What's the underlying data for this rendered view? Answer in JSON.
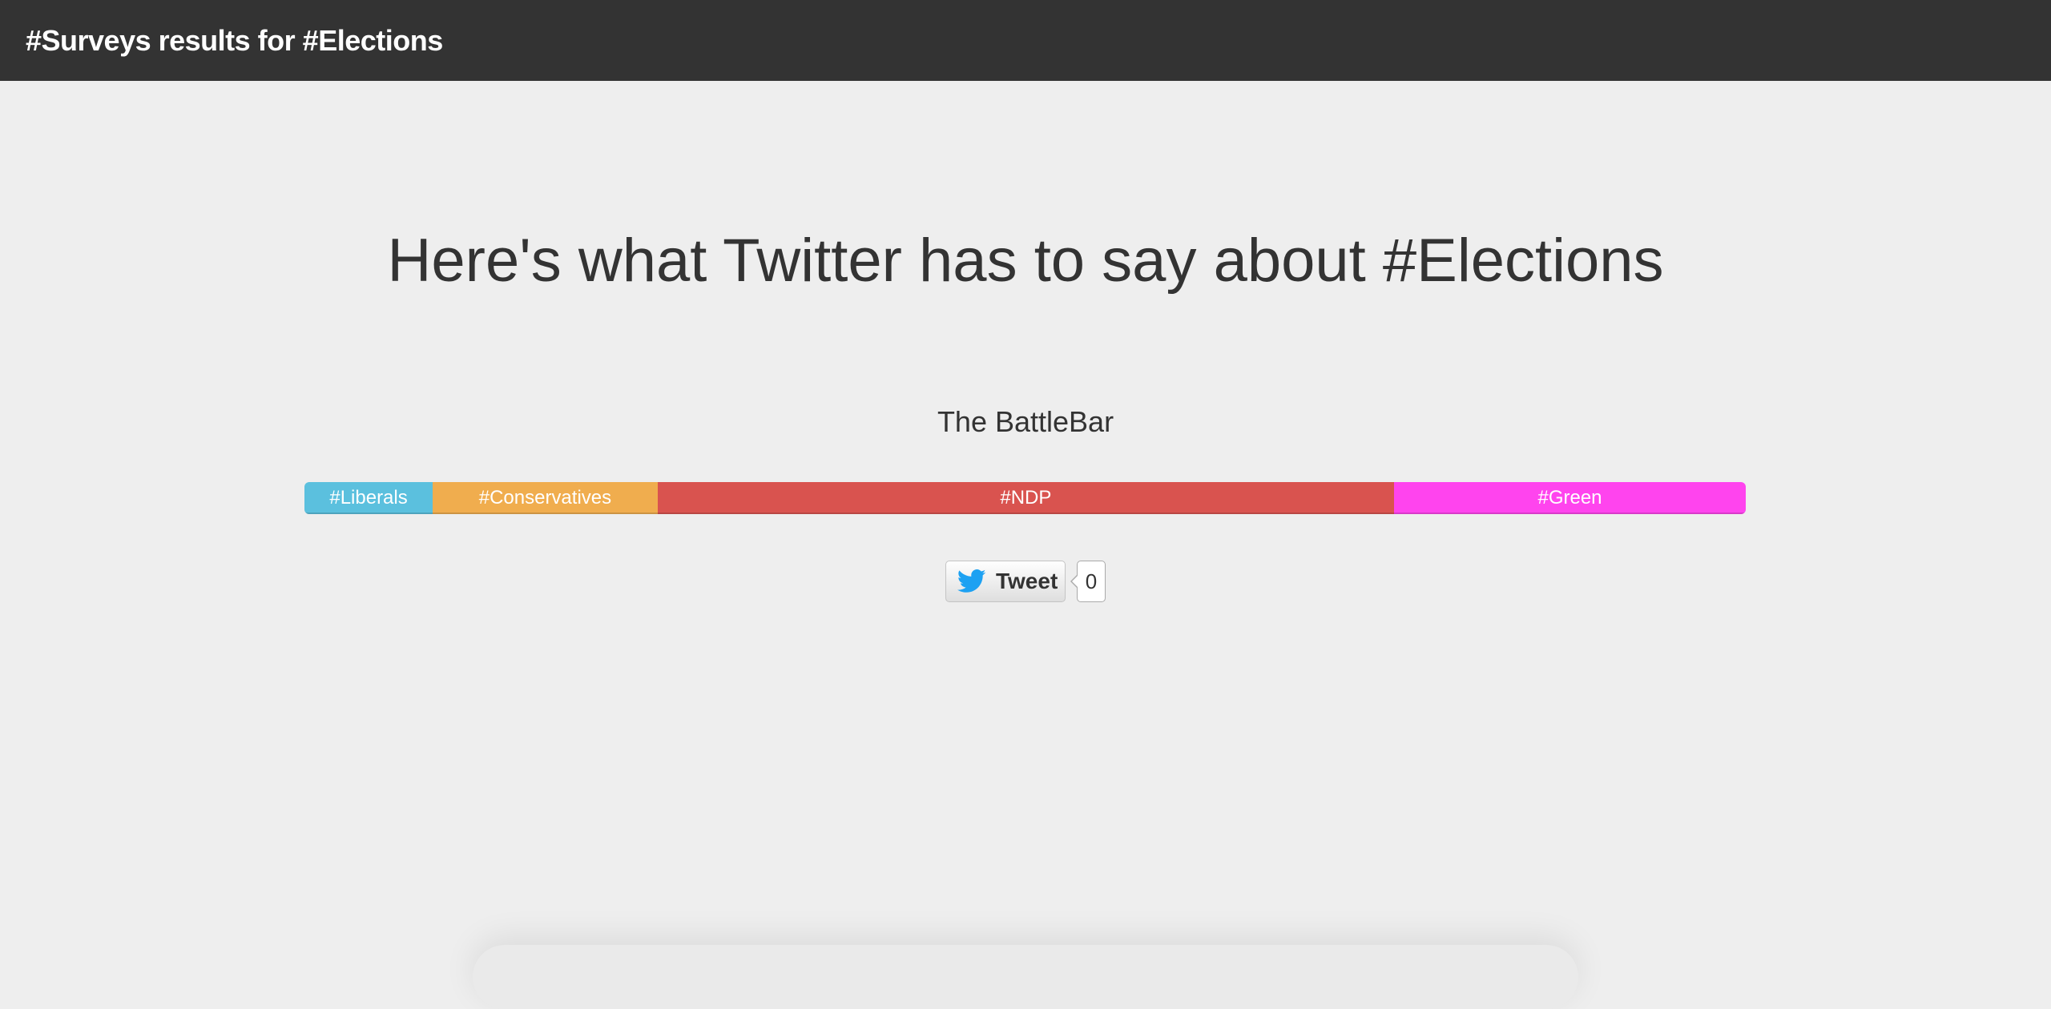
{
  "navbar": {
    "brand": "#Surveys results for #Elections"
  },
  "main": {
    "headline": "Here's what Twitter has to say about #Elections",
    "battlebar_title": "The BattleBar"
  },
  "chart_data": {
    "type": "bar",
    "title": "The BattleBar",
    "categories": [
      "#Liberals",
      "#Conservatives",
      "#NDP",
      "#Green"
    ],
    "values": [
      8.9,
      15.6,
      51.1,
      24.4
    ],
    "unit": "percent of bar width",
    "colors": [
      "#5bc0de",
      "#f0ad4e",
      "#d9534f",
      "#ff44ee"
    ]
  },
  "tweet": {
    "label": "Tweet",
    "count": "0",
    "icon": "twitter-bird-icon",
    "icon_color": "#1da1f2"
  }
}
